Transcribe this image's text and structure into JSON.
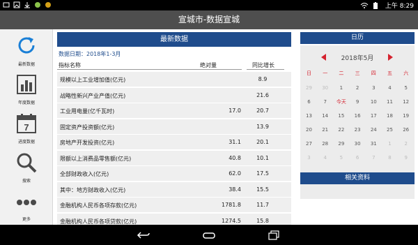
{
  "status": {
    "time": "上午 8:29",
    "left_icons": [
      "message-icon",
      "image-icon",
      "download-icon",
      "android-icon",
      "circle-icon"
    ],
    "right_icons": [
      "wifi-icon",
      "battery-icon"
    ]
  },
  "app": {
    "title": "宣城市-数据宣城"
  },
  "sidebar": {
    "items": [
      {
        "label": "最新数据",
        "icon": "refresh-icon"
      },
      {
        "label": "年度数据",
        "icon": "bar-chart-icon"
      },
      {
        "label": "进度数据",
        "icon": "calendar-icon",
        "icon_text": "7"
      },
      {
        "label": "搜索",
        "icon": "search-icon"
      },
      {
        "label": "更多",
        "icon": "more-icon"
      }
    ]
  },
  "latest": {
    "title": "最新数据",
    "date_label": "数据日期：2018年1-3月",
    "columns": {
      "name": "指标名称",
      "value": "绝对量",
      "growth": "同比增长"
    },
    "rows": [
      {
        "name": "规模以上工业增加值(亿元)",
        "value": "",
        "growth": "8.9"
      },
      {
        "name": "战略性新兴产业产值(亿元)",
        "value": "",
        "growth": "21.6"
      },
      {
        "name": "工业用电量(亿千瓦时)",
        "value": "17.0",
        "growth": "20.7"
      },
      {
        "name": "固定资产投资额(亿元)",
        "value": "",
        "growth": "13.9"
      },
      {
        "name": "房地产开发投资(亿元)",
        "value": "31.1",
        "growth": "20.1"
      },
      {
        "name": "限额以上消费品零售额(亿元)",
        "value": "40.8",
        "growth": "10.1"
      },
      {
        "name": "全部财政收入(亿元)",
        "value": "62.0",
        "growth": "17.5"
      },
      {
        "name": "其中：地方财政收入(亿元)",
        "value": "38.4",
        "growth": "15.5"
      },
      {
        "name": "金融机构人民币各项存款(亿元)",
        "value": "1781.8",
        "growth": "11.7"
      },
      {
        "name": "金融机构人民币各项贷款(亿元)",
        "value": "1274.5",
        "growth": "15.8"
      }
    ]
  },
  "calendar": {
    "title": "日历",
    "month_label": "2018年5月",
    "weekdays": [
      "日",
      "一",
      "二",
      "三",
      "四",
      "五",
      "六"
    ],
    "weeks": [
      [
        {
          "d": "29",
          "t": "grey"
        },
        {
          "d": "30",
          "t": "grey"
        },
        {
          "d": "1",
          "t": "norm"
        },
        {
          "d": "2",
          "t": "norm"
        },
        {
          "d": "3",
          "t": "norm"
        },
        {
          "d": "4",
          "t": "norm"
        },
        {
          "d": "5",
          "t": "norm"
        }
      ],
      [
        {
          "d": "6",
          "t": "norm"
        },
        {
          "d": "7",
          "t": "norm"
        },
        {
          "d": "今天",
          "t": "today"
        },
        {
          "d": "9",
          "t": "norm"
        },
        {
          "d": "10",
          "t": "norm"
        },
        {
          "d": "11",
          "t": "norm"
        },
        {
          "d": "12",
          "t": "norm"
        }
      ],
      [
        {
          "d": "13",
          "t": "norm"
        },
        {
          "d": "14",
          "t": "norm"
        },
        {
          "d": "15",
          "t": "norm"
        },
        {
          "d": "16",
          "t": "norm"
        },
        {
          "d": "17",
          "t": "norm"
        },
        {
          "d": "18",
          "t": "norm"
        },
        {
          "d": "19",
          "t": "norm"
        }
      ],
      [
        {
          "d": "20",
          "t": "norm"
        },
        {
          "d": "21",
          "t": "norm"
        },
        {
          "d": "22",
          "t": "norm"
        },
        {
          "d": "23",
          "t": "norm"
        },
        {
          "d": "24",
          "t": "norm"
        },
        {
          "d": "25",
          "t": "norm"
        },
        {
          "d": "26",
          "t": "norm"
        }
      ],
      [
        {
          "d": "27",
          "t": "norm"
        },
        {
          "d": "28",
          "t": "norm"
        },
        {
          "d": "29",
          "t": "norm"
        },
        {
          "d": "30",
          "t": "norm"
        },
        {
          "d": "31",
          "t": "norm"
        },
        {
          "d": "1",
          "t": "grey"
        },
        {
          "d": "2",
          "t": "grey"
        }
      ],
      [
        {
          "d": "3",
          "t": "grey"
        },
        {
          "d": "4",
          "t": "grey"
        },
        {
          "d": "5",
          "t": "grey"
        },
        {
          "d": "6",
          "t": "grey"
        },
        {
          "d": "7",
          "t": "grey"
        },
        {
          "d": "8",
          "t": "grey"
        },
        {
          "d": "9",
          "t": "grey"
        }
      ]
    ]
  },
  "related": {
    "title": "相关资料"
  },
  "navbar": {
    "buttons": [
      "back-icon",
      "home-icon",
      "recents-icon"
    ]
  },
  "colors": {
    "accent": "#1f4c8c",
    "highlight": "#d5232f",
    "appbar": "#4e4e4e"
  }
}
